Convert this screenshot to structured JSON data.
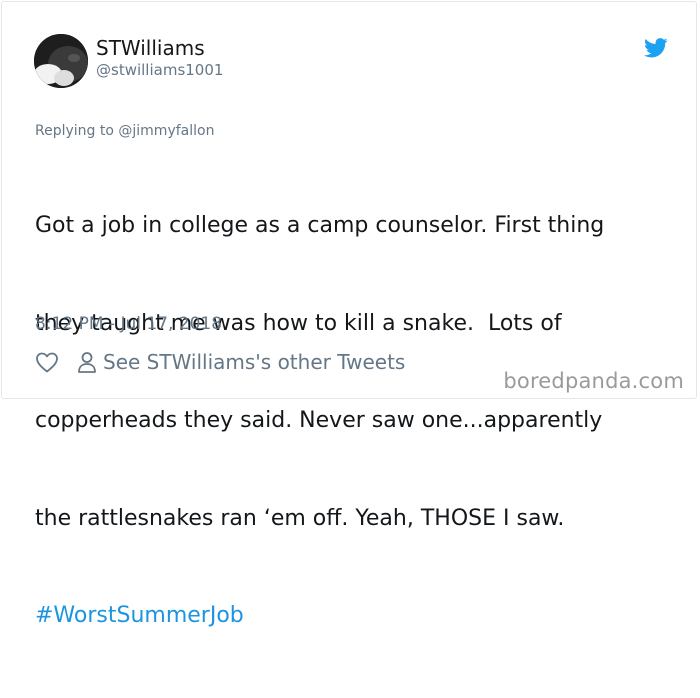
{
  "author": {
    "name": "STWilliams",
    "handle": "@stwilliams1001"
  },
  "reply": {
    "prefix": "Replying to ",
    "mention": "@jimmyfallon"
  },
  "tweet": {
    "lines": [
      "Got a job in college as a camp counselor. First thing",
      "they taught me was how to kill a snake.  Lots of",
      "copperheads they said. Never saw one...apparently",
      "the rattlesnakes ran ‘em off. Yeah, THOSE I saw."
    ],
    "hashtag": "#WorstSummerJob",
    "timestamp": "8:12 PM - Jul 17, 2018"
  },
  "actions": {
    "see_other": "See STWilliams's other Tweets"
  },
  "watermark": "boredpanda.com",
  "icons": {
    "bird": "twitter-bird-icon",
    "like": "heart-icon",
    "profile": "person-icon"
  },
  "colors": {
    "accent": "#1b95e0",
    "secondary_text": "#657786",
    "primary_text": "#14171a"
  }
}
